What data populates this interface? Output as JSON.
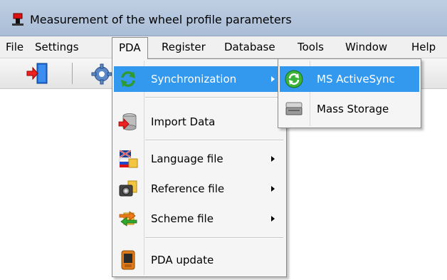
{
  "window": {
    "title": "Measurement of the wheel profile parameters",
    "icon": "caliper-icon"
  },
  "menubar": {
    "items": [
      {
        "label": "File"
      },
      {
        "label": "Settings"
      },
      {
        "label": "PDA",
        "open": true
      },
      {
        "label": "Register"
      },
      {
        "label": "Database"
      },
      {
        "label": "Tools"
      },
      {
        "label": "Window"
      },
      {
        "label": "Help"
      }
    ]
  },
  "toolbar": {
    "buttons": [
      {
        "icon": "exit-door-icon"
      },
      {
        "icon": "gear-icon"
      }
    ]
  },
  "pda_menu": {
    "items": [
      {
        "label": "Synchronization",
        "icon": "sync-arrows-icon",
        "has_submenu": true,
        "highlighted": true
      },
      {
        "label": "Import Data",
        "icon": "database-import-icon"
      },
      {
        "label": "Language file",
        "icon": "flag-folder-icon",
        "has_submenu": true
      },
      {
        "label": "Reference file",
        "icon": "camera-folder-icon",
        "has_submenu": true
      },
      {
        "label": "Scheme file",
        "icon": "swap-arrows-icon",
        "has_submenu": true
      },
      {
        "label": "PDA update",
        "icon": "pda-device-icon"
      }
    ]
  },
  "sync_submenu": {
    "items": [
      {
        "label": "MS ActiveSync",
        "icon": "activesync-icon",
        "highlighted": true
      },
      {
        "label": "Mass Storage",
        "icon": "scanner-drive-icon"
      }
    ]
  },
  "colors": {
    "highlight": "#3399ee",
    "menu_bg": "#f5f5f5",
    "titlebar": "#b4c7dd"
  }
}
